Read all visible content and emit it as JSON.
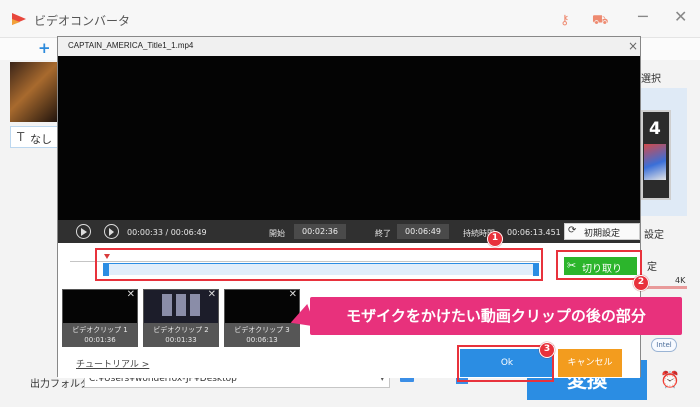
{
  "app": {
    "title": "ビデオコンバータ",
    "subtitle_label": "なし",
    "right_select_label": "選択",
    "right_card_label": "4",
    "right_settings_label": "設定",
    "right_fixed_label": "定",
    "right_4k_label": "4K",
    "right_intel_label": "Intel",
    "output_label": "出力フォルダ：",
    "output_path": "C:¥Users¥wonderfox-JP¥Desktop",
    "convert_button": "変換",
    "icons": {
      "minimize": "─",
      "close": "✕",
      "plus": "+",
      "subtitle": "T",
      "dropdown": "▾",
      "alarm": "⏰"
    }
  },
  "modal": {
    "title": "CAPTAIN_AMERICA_Title1_1.mp4",
    "close_glyph": "×",
    "current_time": "00:00:33 / 00:06:49",
    "start_label": "開始",
    "start_value": "00:02:36",
    "end_label": "終了",
    "end_value": "00:06:49",
    "duration_label": "持続時間",
    "duration_value": "00:06:13.451",
    "reset_label": "初期設定",
    "reset_glyph": "⟳",
    "cut_label": "切り取り",
    "cut_glyph": "✂",
    "clips": [
      {
        "name": "ビデオクリップ 1",
        "duration": "00:01:36",
        "close": "✕"
      },
      {
        "name": "ビデオクリップ 2",
        "duration": "00:01:33",
        "close": "✕"
      },
      {
        "name": "ビデオクリップ 3",
        "duration": "00:06:13",
        "close": "✕"
      }
    ],
    "tutorial_link": "チュートリアル >",
    "ok_label": "Ok",
    "cancel_label": "キャンセル"
  },
  "annotations": {
    "badges": [
      "1",
      "2",
      "3"
    ],
    "callout": "モザイクをかけたい動画クリップの後の部分"
  },
  "colors": {
    "accent_blue": "#2b8de3",
    "cut_green": "#2cb52c",
    "cancel_orange": "#f39c1e",
    "highlight_red": "#e8323c",
    "callout_pink": "#e8317c"
  }
}
